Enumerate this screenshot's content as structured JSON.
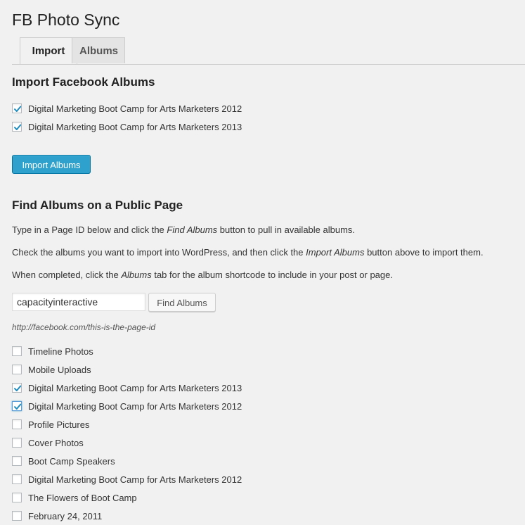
{
  "page": {
    "title": "FB Photo Sync"
  },
  "tabs": [
    {
      "label": "Import",
      "active": true
    },
    {
      "label": "Albums",
      "active": false
    }
  ],
  "import_section": {
    "heading": "Import Facebook Albums",
    "albums": [
      {
        "label": "Digital Marketing Boot Camp for Arts Marketers 2012",
        "checked": true
      },
      {
        "label": "Digital Marketing Boot Camp for Arts Marketers 2013",
        "checked": true
      }
    ],
    "import_button": "Import Albums"
  },
  "find_section": {
    "heading": "Find Albums on a Public Page",
    "instructions": [
      {
        "before": "Type in a Page ID below and click the ",
        "em": "Find Albums",
        "after": " button to pull in available albums."
      },
      {
        "before": "Check the albums you want to import into WordPress, and then click the ",
        "em": "Import Albums",
        "after": " button above to import them."
      },
      {
        "before": "When completed, click the ",
        "em": "Albums",
        "after": " tab for the album shortcode to include in your post or page."
      }
    ],
    "page_id_value": "capacityinteractive",
    "find_button": "Find Albums",
    "url_hint": "http://facebook.com/this-is-the-page-id",
    "albums": [
      {
        "label": "Timeline Photos",
        "checked": false
      },
      {
        "label": "Mobile Uploads",
        "checked": false
      },
      {
        "label": "Digital Marketing Boot Camp for Arts Marketers 2013",
        "checked": true
      },
      {
        "label": "Digital Marketing Boot Camp for Arts Marketers 2012",
        "checked": true,
        "focused": true
      },
      {
        "label": "Profile Pictures",
        "checked": false
      },
      {
        "label": "Cover Photos",
        "checked": false
      },
      {
        "label": "Boot Camp Speakers",
        "checked": false
      },
      {
        "label": "Digital Marketing Boot Camp for Arts Marketers 2012",
        "checked": false
      },
      {
        "label": "The Flowers of Boot Camp",
        "checked": false
      },
      {
        "label": "February 24, 2011",
        "checked": false
      }
    ]
  },
  "colors": {
    "accent": "#2ea2cc",
    "checkmark": "#1e8cbe"
  }
}
